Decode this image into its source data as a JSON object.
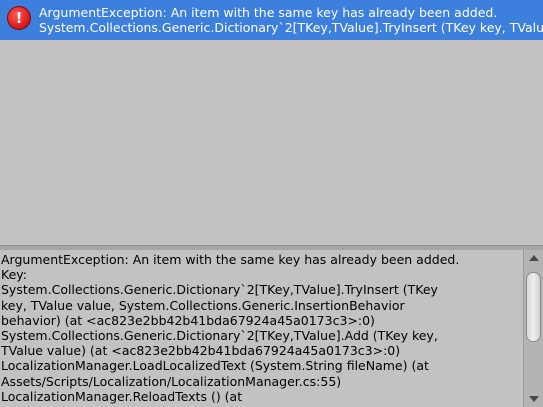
{
  "console": {
    "entries": [
      {
        "type": "error",
        "line1": "ArgumentException: An item with the same key has already been added.",
        "line2": "System.Collections.Generic.Dictionary`2[TKey,TValue].TryInsert (TKey key, TValue value,"
      }
    ]
  },
  "detail": {
    "lines": [
      "ArgumentException: An item with the same key has already been added.",
      "Key:",
      "System.Collections.Generic.Dictionary`2[TKey,TValue].TryInsert (TKey",
      "key, TValue value, System.Collections.Generic.InsertionBehavior",
      "behavior) (at <ac823e2bb42b41bda67924a45a0173c3>:0)",
      "System.Collections.Generic.Dictionary`2[TKey,TValue].Add (TKey key,",
      "TValue value) (at <ac823e2bb42b41bda67924a45a0173c3>:0)",
      "LocalizationManager.LoadLocalizedText (System.String fileName) (at",
      "Assets/Scripts/Localization/LocalizationManager.cs:55)",
      "LocalizationManager.ReloadTexts () (at"
    ]
  },
  "colors": {
    "selection": "#3d7fdc",
    "background": "#c2c2c2",
    "error": "#e02222"
  },
  "icons": {
    "entry_icon": "error-icon",
    "scroll_up": "arrow-up-icon",
    "scroll_down": "arrow-down-icon"
  }
}
